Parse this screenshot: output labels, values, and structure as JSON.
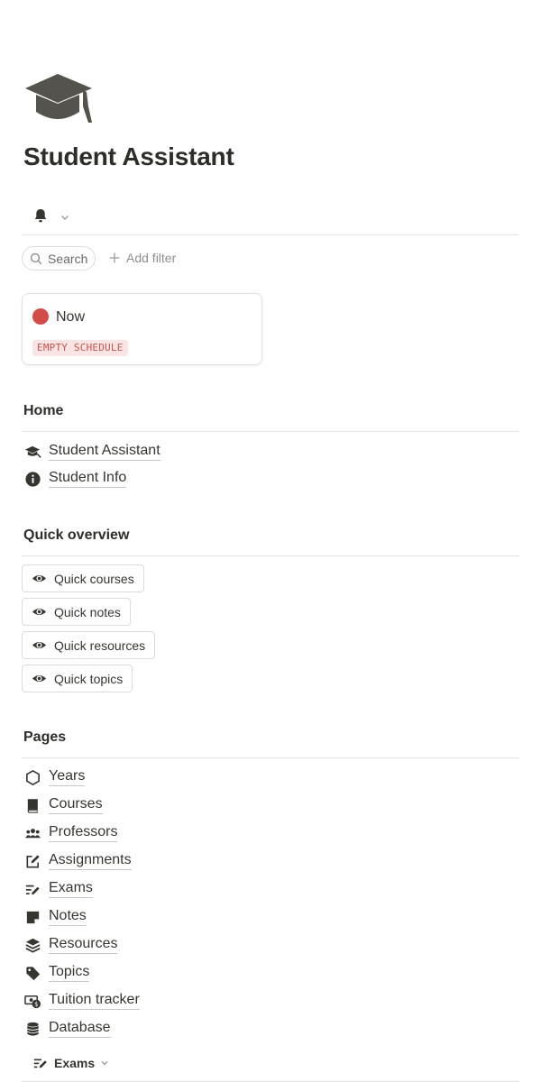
{
  "page": {
    "title": "Student Assistant",
    "icon": "graduation-cap-icon"
  },
  "toolbar": {
    "bell_icon": "bell-icon",
    "dropdown_icon": "chevron-down-icon"
  },
  "filters": {
    "search_label": "Search",
    "add_filter_label": "Add filter"
  },
  "now_card": {
    "label": "Now",
    "status_color": "#d44c47",
    "badge": "EMPTY SCHEDULE"
  },
  "home": {
    "heading": "Home",
    "links": [
      {
        "label": "Student Assistant",
        "icon": "graduation-cap-icon"
      },
      {
        "label": "Student Info",
        "icon": "info-icon"
      }
    ]
  },
  "quick_overview": {
    "heading": "Quick overview",
    "buttons": [
      {
        "label": "Quick courses",
        "icon": "eye-icon"
      },
      {
        "label": "Quick notes",
        "icon": "eye-icon"
      },
      {
        "label": "Quick resources",
        "icon": "eye-icon"
      },
      {
        "label": "Quick topics",
        "icon": "eye-icon"
      }
    ]
  },
  "pages": {
    "heading": "Pages",
    "links": [
      {
        "label": "Years",
        "icon": "hexagon-icon"
      },
      {
        "label": "Courses",
        "icon": "book-icon"
      },
      {
        "label": "Professors",
        "icon": "people-icon"
      },
      {
        "label": "Assignments",
        "icon": "edit-square-icon"
      },
      {
        "label": "Exams",
        "icon": "pencil-lines-icon"
      },
      {
        "label": "Notes",
        "icon": "sticky-note-icon"
      },
      {
        "label": "Resources",
        "icon": "layers-icon"
      },
      {
        "label": "Topics",
        "icon": "tag-icon"
      },
      {
        "label": "Tuition tracker",
        "icon": "money-icon"
      },
      {
        "label": "Database",
        "icon": "database-icon"
      }
    ]
  },
  "bottom_tab": {
    "label": "Exams",
    "icon": "pencil-lines-icon"
  },
  "colors": {
    "text": "#37352f",
    "muted": "#8f8e8a",
    "divider": "#e2e2df",
    "badge_bg": "#fbe4e4",
    "badge_text": "#c4554d"
  }
}
